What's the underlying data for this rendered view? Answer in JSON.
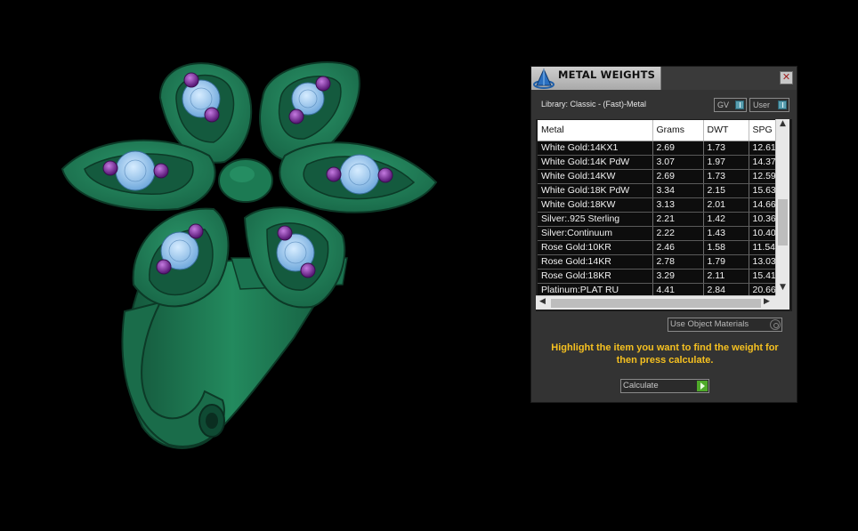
{
  "panel": {
    "title": "METAL WEIGHTS",
    "close_glyph": "✕",
    "library_label": "Library: Classic - (Fast)-Metal",
    "toggle_gv": "GV",
    "toggle_user": "User",
    "columns": [
      "Metal",
      "Grams",
      "DWT",
      "SPG"
    ],
    "rows": [
      [
        "White Gold:14KX1",
        "2.69",
        "1.73",
        "12.61"
      ],
      [
        "White Gold:14K PdW",
        "3.07",
        "1.97",
        "14.37"
      ],
      [
        "White Gold:14KW",
        "2.69",
        "1.73",
        "12.59"
      ],
      [
        "White Gold:18K PdW",
        "3.34",
        "2.15",
        "15.63"
      ],
      [
        "White Gold:18KW",
        "3.13",
        "2.01",
        "14.66"
      ],
      [
        "Silver:.925 Sterling",
        "2.21",
        "1.42",
        "10.36"
      ],
      [
        "Silver:Continuum",
        "2.22",
        "1.43",
        "10.40"
      ],
      [
        "Rose Gold:10KR",
        "2.46",
        "1.58",
        "11.54"
      ],
      [
        "Rose Gold:14KR",
        "2.78",
        "1.79",
        "13.03"
      ],
      [
        "Rose Gold:18KR",
        "3.29",
        "2.11",
        "15.41"
      ],
      [
        "Platinum:PLAT RU",
        "4.41",
        "2.84",
        "20.66"
      ]
    ],
    "material_dropdown": "Use Object Materials",
    "hint": "Highlight the item you want to find the weight for then press calculate.",
    "calculate_label": "Calculate"
  },
  "icons": {
    "title": "pyramid-logo-icon",
    "close": "close-icon",
    "scroll_up": "▲",
    "scroll_down": "▼",
    "scroll_left": "◀",
    "scroll_right": "▶"
  },
  "colors": {
    "metal": "#1f7a55",
    "stone_center": "#8cc4f2",
    "stone_accent": "#7a2a9a",
    "hint": "#f5c020",
    "go_button": "#4faa2a"
  }
}
